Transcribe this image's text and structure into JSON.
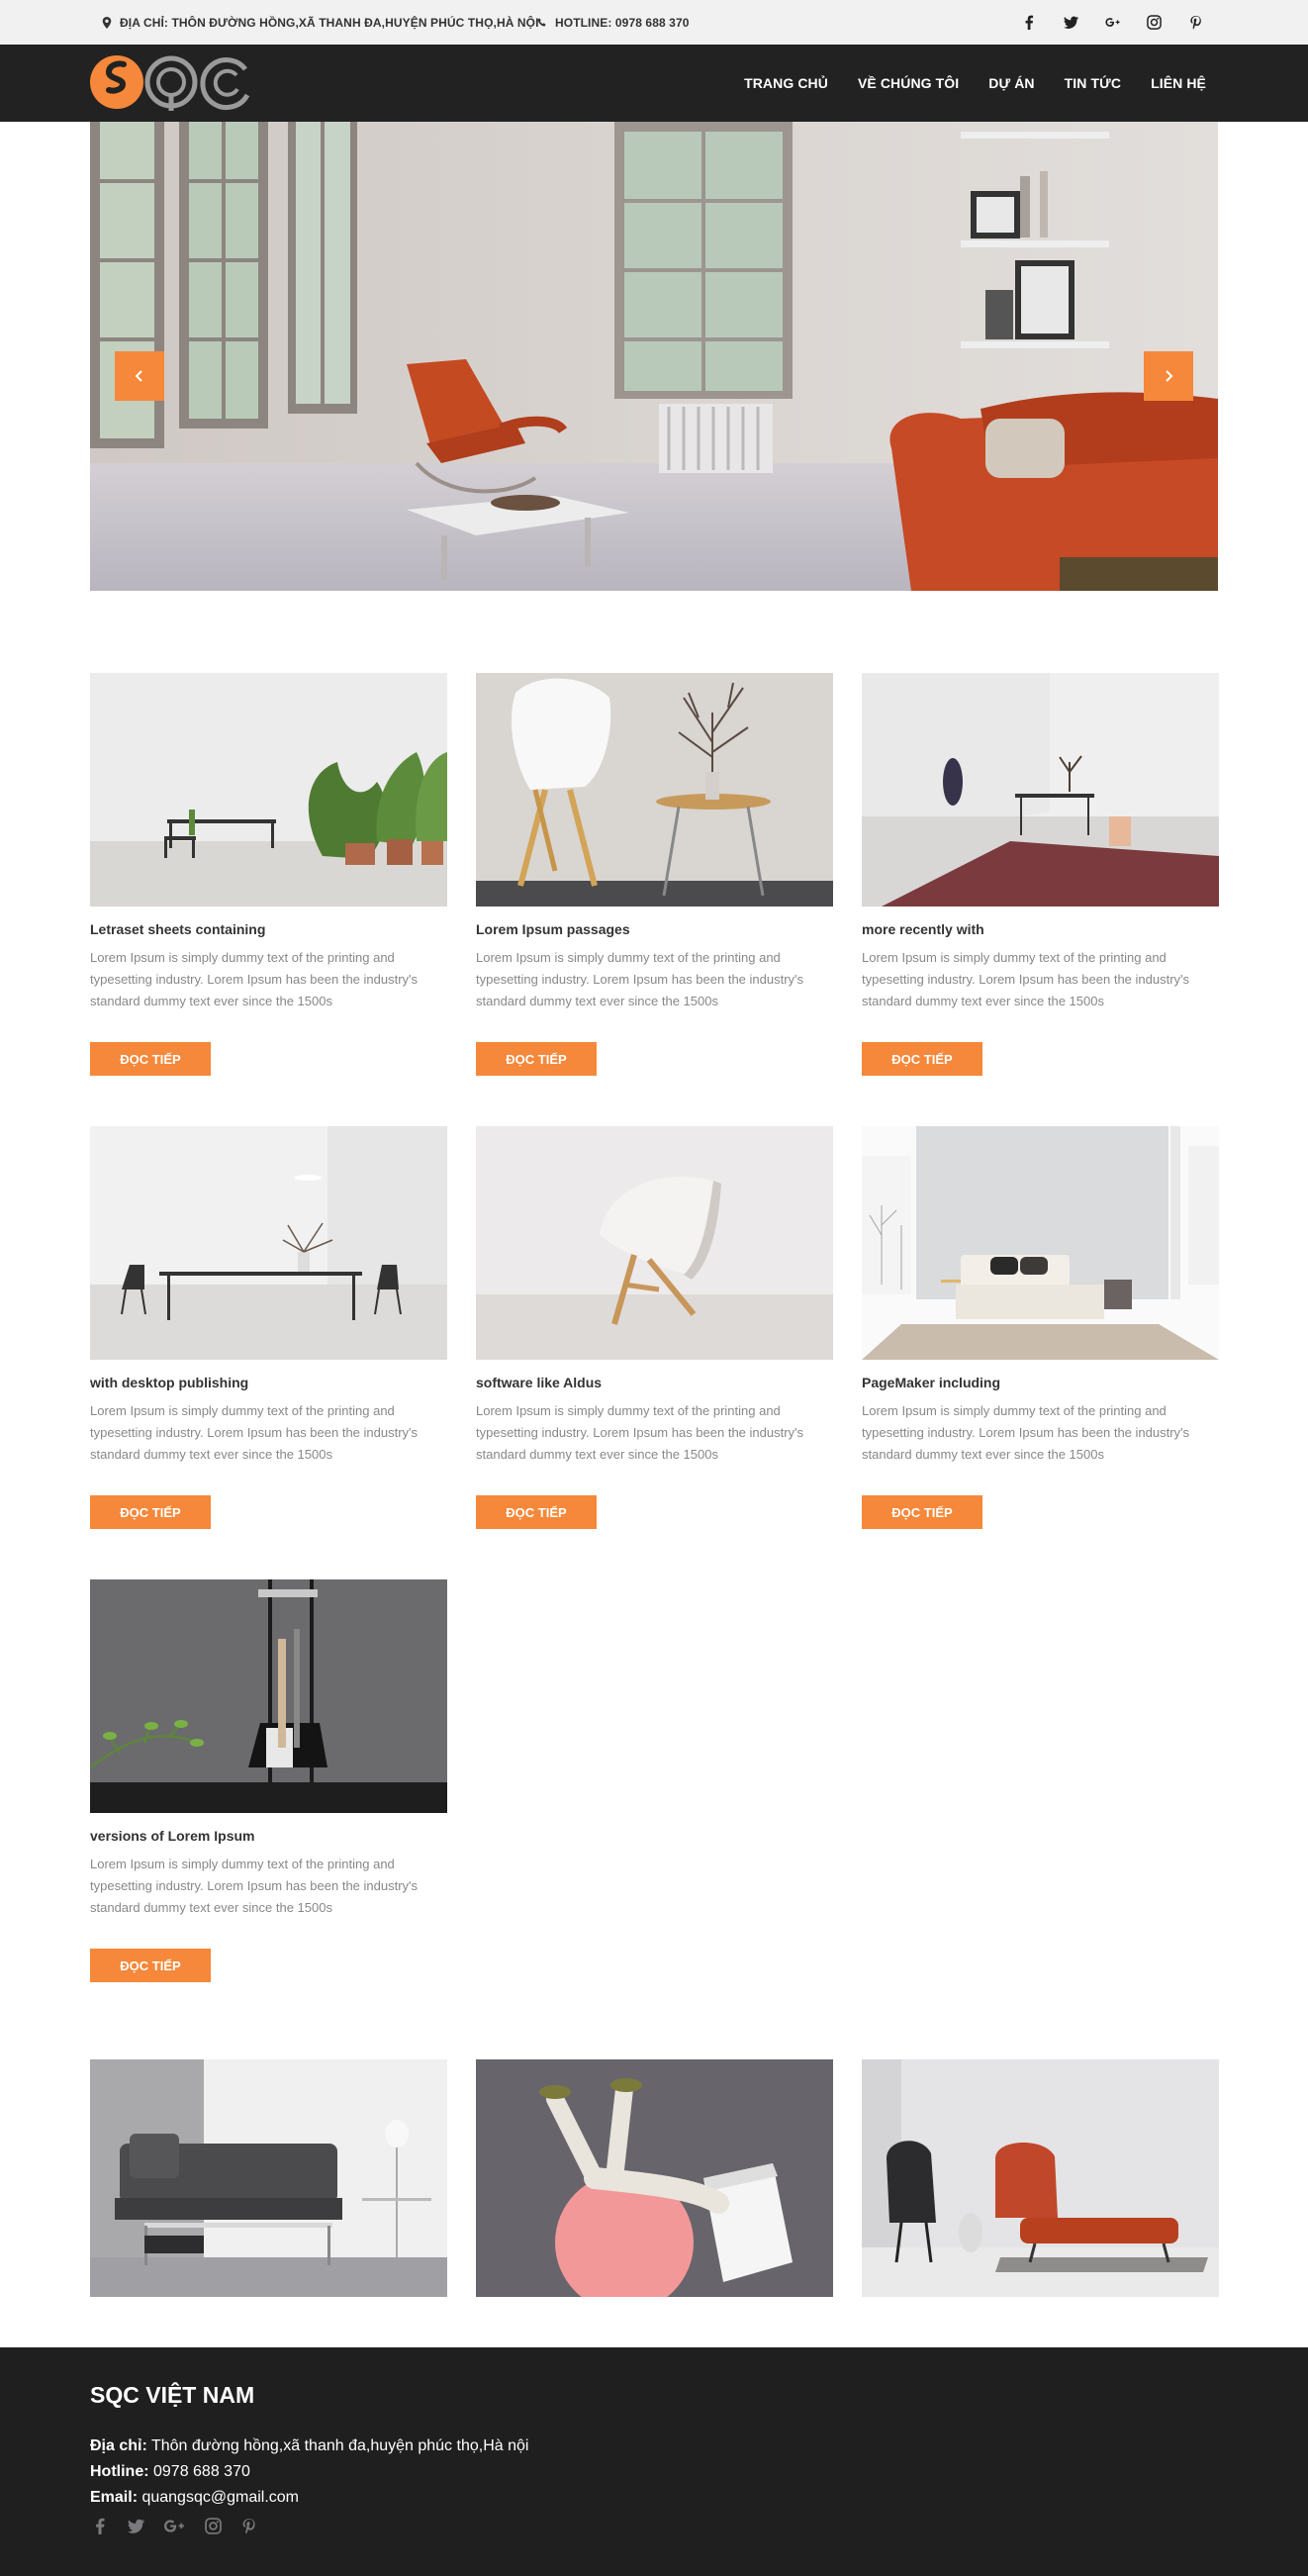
{
  "topbar": {
    "address": "ĐỊA CHỈ: THÔN ĐƯỜNG HỒNG,XÃ THANH ĐA,HUYỆN PHÚC THỌ,HÀ NỘI",
    "hotline": "HOTLINE: 0978 688 370",
    "social": [
      "facebook-icon",
      "twitter-icon",
      "google-plus-icon",
      "instagram-icon",
      "pinterest-icon"
    ]
  },
  "nav": {
    "items": [
      "TRANG CHỦ",
      "VỀ CHÚNG TÔI",
      "DỰ ÁN",
      "TIN TỨC",
      "LIÊN HỆ"
    ]
  },
  "colors": {
    "accent": "#f5883a",
    "header": "#222222",
    "footer": "#1f1f20",
    "topbar": "#f1f1f1"
  },
  "projects": [
    {
      "title": "Letraset sheets containing",
      "desc": "Lorem Ipsum is simply dummy text of the printing and typesetting industry. Lorem Ipsum has been the industry's standard dummy text ever since the 1500s",
      "button": "ĐỌC TIẾP"
    },
    {
      "title": "Lorem Ipsum passages",
      "desc": "Lorem Ipsum is simply dummy text of the printing and typesetting industry. Lorem Ipsum has been the industry's standard dummy text ever since the 1500s",
      "button": "ĐỌC TIẾP"
    },
    {
      "title": "more recently with",
      "desc": "Lorem Ipsum is simply dummy text of the printing and typesetting industry. Lorem Ipsum has been the industry's standard dummy text ever since the 1500s",
      "button": "ĐỌC TIẾP"
    },
    {
      "title": "with desktop publishing",
      "desc": "Lorem Ipsum is simply dummy text of the printing and typesetting industry. Lorem Ipsum has been the industry's standard dummy text ever since the 1500s",
      "button": "ĐỌC TIẾP"
    },
    {
      "title": "software like Aldus",
      "desc": "Lorem Ipsum is simply dummy text of the printing and typesetting industry. Lorem Ipsum has been the industry's standard dummy text ever since the 1500s",
      "button": "ĐỌC TIẾP"
    },
    {
      "title": "PageMaker including",
      "desc": "Lorem Ipsum is simply dummy text of the printing and typesetting industry. Lorem Ipsum has been the industry's standard dummy text ever since the 1500s",
      "button": "ĐỌC TIẾP"
    },
    {
      "title": "versions of Lorem Ipsum",
      "desc": "Lorem Ipsum is simply dummy text of the printing and typesetting industry. Lorem Ipsum has been the industry's standard dummy text ever since the 1500s",
      "button": "ĐỌC TIẾP"
    }
  ],
  "footer": {
    "company": "SQC VIỆT NAM",
    "address_label": "Địa chỉ:",
    "address": " Thôn đường hồng,xã thanh đa,huyện phúc thọ,Hà nội",
    "hotline_label": "Hotline:",
    "hotline": " 0978 688 370",
    "email_label": "Email:",
    "email": " quangsqc@gmail.com",
    "social": [
      "facebook-icon",
      "twitter-icon",
      "google-plus-icon",
      "instagram-icon",
      "pinterest-icon"
    ]
  }
}
